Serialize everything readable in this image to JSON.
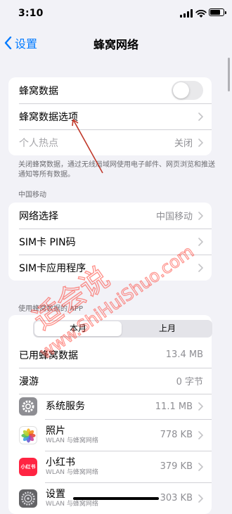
{
  "status_bar": {
    "time": "3:10",
    "battery_level": 0.9
  },
  "nav": {
    "back_label": "设置",
    "title": "蜂窝网络"
  },
  "main_section": {
    "cellular_data": {
      "label": "蜂窝数据",
      "toggle_on": false
    },
    "cellular_options": {
      "label": "蜂窝数据选项"
    },
    "hotspot": {
      "label": "个人热点",
      "value": "关闭"
    }
  },
  "footnote": "关闭蜂窝数据，通过无线局域网使用电子邮件、网页浏览和推送通知等所有数据。",
  "carrier_section": {
    "header": "中国移动",
    "items": [
      {
        "label": "网络选择",
        "value": "中国移动"
      },
      {
        "label": "SIM卡 PIN码",
        "value": ""
      },
      {
        "label": "SIM卡应用程序",
        "value": ""
      }
    ]
  },
  "usage_section": {
    "header": "使用蜂窝数据的 APP",
    "tabs": [
      "本月",
      "上月"
    ],
    "active_tab": 0,
    "stats": [
      {
        "label": "已用蜂窝数据",
        "value": "13.4 MB"
      },
      {
        "label": "漫游",
        "value": "0 字节"
      }
    ],
    "apps": [
      {
        "icon": "gear-icon",
        "name": "系统服务",
        "sub": "",
        "value": "11.1 MB",
        "color": "#8e8e93"
      },
      {
        "icon": "photos-icon",
        "name": "照片",
        "sub": "WLAN 与蜂窝网络",
        "value": "778 KB",
        "color": "#ffffff"
      },
      {
        "icon": "xiaohongshu-icon",
        "name": "小红书",
        "sub": "WLAN 与蜂窝网络",
        "value": "379 KB",
        "color": "#ff2442",
        "icon_text": "小红书"
      },
      {
        "icon": "settings-icon",
        "name": "设置",
        "sub": "WLAN 与蜂窝网络",
        "value": "303 KB",
        "color": "#8e8e93"
      }
    ]
  },
  "watermark": {
    "text_cn": "适会说",
    "text_en": "www.ShiHuiShuo.com",
    "color": "#ff3b30"
  },
  "colors": {
    "accent": "#007aff",
    "background": "#f2f2f7"
  }
}
